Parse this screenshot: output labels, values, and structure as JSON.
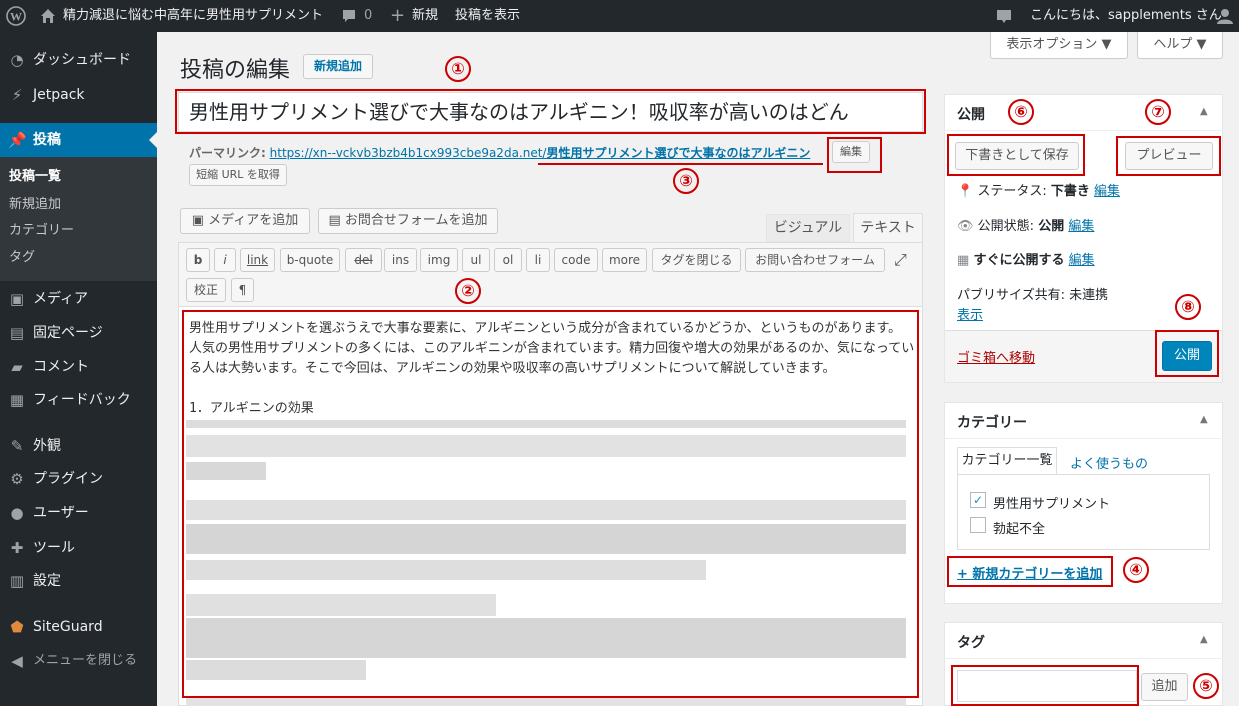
{
  "adminbar": {
    "site_title": "精力減退に悩む中高年に男性用サプリメント",
    "comments_count": "0",
    "new_label": "新規",
    "view_post": "投稿を表示",
    "greeting": "こんにちは、sapplements さん"
  },
  "sidebar": {
    "dashboard": "ダッシュボード",
    "jetpack": "Jetpack",
    "posts": "投稿",
    "posts_submenu": [
      "投稿一覧",
      "新規追加",
      "カテゴリー",
      "タグ"
    ],
    "media": "メディア",
    "pages": "固定ページ",
    "comments": "コメント",
    "feedback": "フィードバック",
    "appearance": "外観",
    "plugins": "プラグイン",
    "users": "ユーザー",
    "tools": "ツール",
    "settings": "設定",
    "siteguard": "SiteGuard",
    "collapse": "メニューを閉じる"
  },
  "screen_options": "表示オプション ▼",
  "help": "ヘルプ ▼",
  "page_title": "投稿の編集",
  "add_new": "新規追加",
  "post_title": "男性用サプリメント選びで大事なのはアルギニン！吸収率が高いのはどん",
  "permalink": {
    "label": "パーマリンク:",
    "base": "https://xn--vckvb3bzb4b1cx993cbe9a2da.net/",
    "slug": "男性用サプリメント選びで大事なのはアルギニン",
    "edit": "編集",
    "shortlink": "短縮 URL を取得"
  },
  "media_buttons": {
    "add_media": "メディアを追加",
    "add_form": "お問合せフォームを追加"
  },
  "editor_tabs": {
    "visual": "ビジュアル",
    "text": "テキスト"
  },
  "quicktags": [
    "b",
    "i",
    "link",
    "b-quote",
    "del",
    "ins",
    "img",
    "ul",
    "ol",
    "li",
    "code",
    "more",
    "タグを閉じる",
    "お問い合わせフォーム"
  ],
  "quicktags_row2": [
    "校正",
    "¶"
  ],
  "content": {
    "p1": "男性用サプリメントを選ぶうえで大事な要素に、アルギニンという成分が含まれているかどうか、というものがあります。",
    "p2": "人気の男性用サプリメントの多くには、このアルギニンが含まれています。精力回復や増大の効果があるのか、気になってい",
    "p3": "る人は大勢います。そこで今回は、アルギニンの効果や吸収率の高いサプリメントについて解説していきます。",
    "h1": "1．アルギニンの効果"
  },
  "publish": {
    "title": "公開",
    "save_draft": "下書きとして保存",
    "preview": "プレビュー",
    "status_label": "ステータス:",
    "status_value": "下書き",
    "visibility_label": "公開状態:",
    "visibility_value": "公開",
    "schedule": "すぐに公開する",
    "edit": "編集",
    "publicize_label": "パブリサイズ共有: 未連携",
    "publicize_show": "表示",
    "trash": "ゴミ箱へ移動",
    "publish_btn": "公開"
  },
  "categories": {
    "title": "カテゴリー",
    "tab_all": "カテゴリー一覧",
    "tab_popular": "よく使うもの",
    "items": [
      "男性用サプリメント",
      "勃起不全"
    ],
    "add_new": "+ 新規カテゴリーを追加"
  },
  "tags": {
    "title": "タグ",
    "add": "追加"
  },
  "annotations": [
    "①",
    "②",
    "③",
    "④",
    "⑤",
    "⑥",
    "⑦",
    "⑧"
  ]
}
